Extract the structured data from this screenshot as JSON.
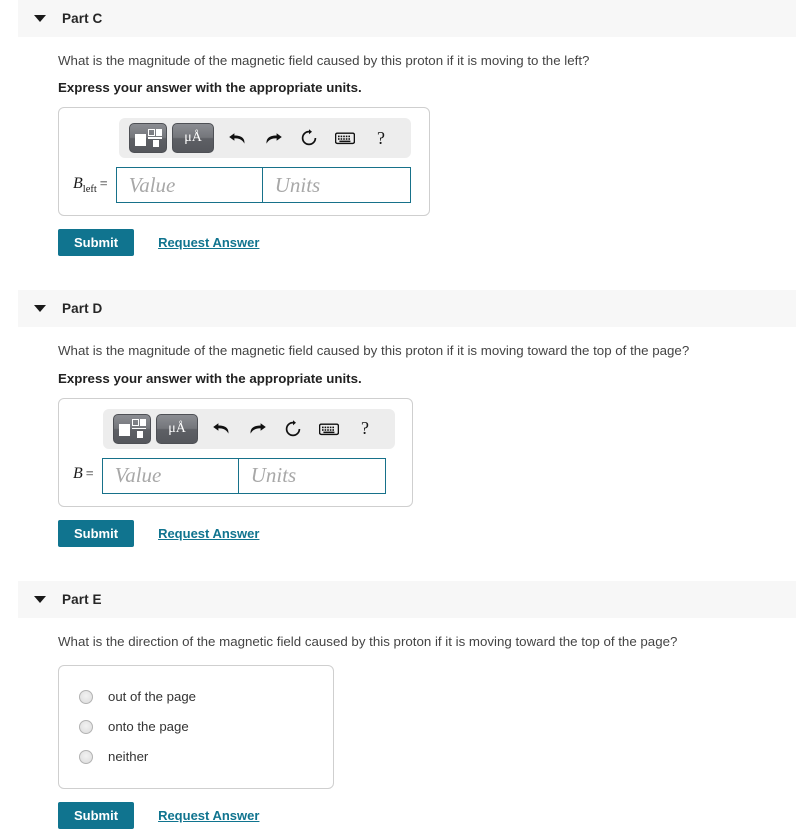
{
  "parts": [
    {
      "id": "part-c",
      "title": "Part C",
      "question": "What is the magnitude of the magnetic field caused by this proton if it is moving to the left?",
      "instruction": "Express your answer with the appropriate units.",
      "answer": {
        "variable": "B",
        "subscript": "left",
        "equals": "=",
        "value_placeholder": "Value",
        "units_placeholder": "Units",
        "value": "",
        "units": ""
      },
      "toolbar": {
        "template_button": "template-icon",
        "units_button": "μÅ",
        "undo": "undo-arrow-icon",
        "redo": "redo-arrow-icon",
        "reset": "reset-circle-icon",
        "keyboard": "keyboard-icon",
        "help": "?"
      },
      "submit_label": "Submit",
      "request_label": "Request Answer"
    },
    {
      "id": "part-d",
      "title": "Part D",
      "question": "What is the magnitude of the magnetic field caused by this proton if it is moving toward the top of the page?",
      "instruction": "Express your answer with the appropriate units.",
      "answer": {
        "variable": "B",
        "subscript": "",
        "equals": "=",
        "value_placeholder": "Value",
        "units_placeholder": "Units",
        "value": "",
        "units": ""
      },
      "toolbar": {
        "template_button": "template-icon",
        "units_button": "μÅ",
        "undo": "undo-arrow-icon",
        "redo": "redo-arrow-icon",
        "reset": "reset-circle-icon",
        "keyboard": "keyboard-icon",
        "help": "?"
      },
      "submit_label": "Submit",
      "request_label": "Request Answer"
    },
    {
      "id": "part-e",
      "title": "Part E",
      "question": "What is the direction of the magnetic field caused by this proton if it is moving toward the top of the page?",
      "options": [
        {
          "label": "out of the page",
          "selected": false
        },
        {
          "label": "onto the page",
          "selected": false
        },
        {
          "label": "neither",
          "selected": false
        }
      ],
      "submit_label": "Submit",
      "request_label": "Request Answer"
    }
  ],
  "colors": {
    "accent_teal": "#10748f",
    "header_bar": "#f7f7f7",
    "input_border": "#17718a",
    "panel_border": "#cfcfcf",
    "toolbar_bg": "#ededed"
  }
}
